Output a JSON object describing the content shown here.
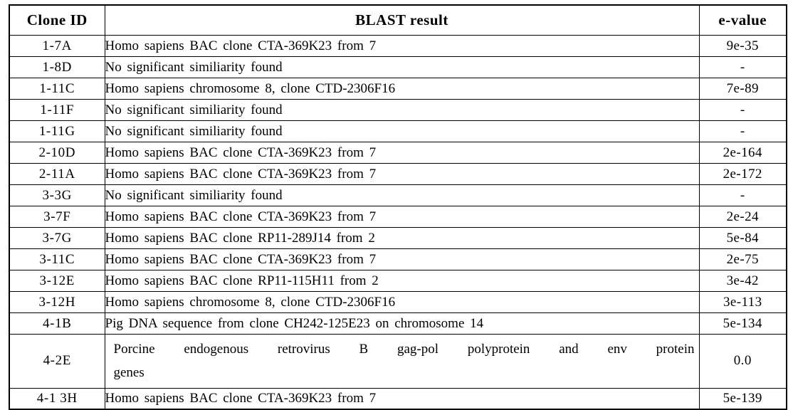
{
  "table": {
    "columns": [
      {
        "key": "clone_id",
        "label": "Clone ID"
      },
      {
        "key": "blast_result",
        "label": "BLAST result"
      },
      {
        "key": "e_value",
        "label": "e-value"
      }
    ],
    "rows": [
      {
        "clone_id": "1-7A",
        "blast_result": "Homo sapiens BAC clone CTA-369K23 from 7",
        "e_value": "9e-35"
      },
      {
        "clone_id": "1-8D",
        "blast_result": "No significant similiarity found",
        "e_value": "-"
      },
      {
        "clone_id": "1-11C",
        "blast_result": "Homo sapiens chromosome 8, clone CTD-2306F16",
        "e_value": "7e-89"
      },
      {
        "clone_id": "1-11F",
        "blast_result": "No significant similiarity found",
        "e_value": "-"
      },
      {
        "clone_id": "1-11G",
        "blast_result": "No significant similiarity found",
        "e_value": "-"
      },
      {
        "clone_id": "2-10D",
        "blast_result": "Homo sapiens BAC clone CTA-369K23 from 7",
        "e_value": "2e-164"
      },
      {
        "clone_id": "2-11A",
        "blast_result": "Homo sapiens BAC clone CTA-369K23 from 7",
        "e_value": "2e-172"
      },
      {
        "clone_id": "3-3G",
        "blast_result": "No significant similiarity found",
        "e_value": "-"
      },
      {
        "clone_id": "3-7F",
        "blast_result": "Homo sapiens BAC clone CTA-369K23 from 7",
        "e_value": "2e-24"
      },
      {
        "clone_id": "3-7G",
        "blast_result": "Homo sapiens BAC clone RP11-289J14 from 2",
        "e_value": "5e-84"
      },
      {
        "clone_id": "3-11C",
        "blast_result": "Homo sapiens BAC clone CTA-369K23 from 7",
        "e_value": "2e-75"
      },
      {
        "clone_id": "3-12E",
        "blast_result": "Homo sapiens BAC clone RP11-115H11 from 2",
        "e_value": "3e-42"
      },
      {
        "clone_id": "3-12H",
        "blast_result": "Homo sapiens chromosome 8, clone CTD-2306F16",
        "e_value": "3e-113"
      },
      {
        "clone_id": "4-1B",
        "blast_result": "Pig DNA sequence from clone CH242-125E23 on chromosome 14",
        "e_value": "5e-134"
      },
      {
        "clone_id": "4-2E",
        "blast_result": "Porcine endogenous retrovirus B gag-pol polyprotein and env protein genes",
        "blast_result_line1": "Porcine endogenous retrovirus B gag-pol polyprotein and env protein",
        "blast_result_line2": "genes",
        "e_value": "0.0",
        "tall": true
      },
      {
        "clone_id": "4-1 3H",
        "blast_result": "Homo sapiens BAC clone CTA-369K23 from 7",
        "e_value": "5e-139"
      }
    ]
  }
}
